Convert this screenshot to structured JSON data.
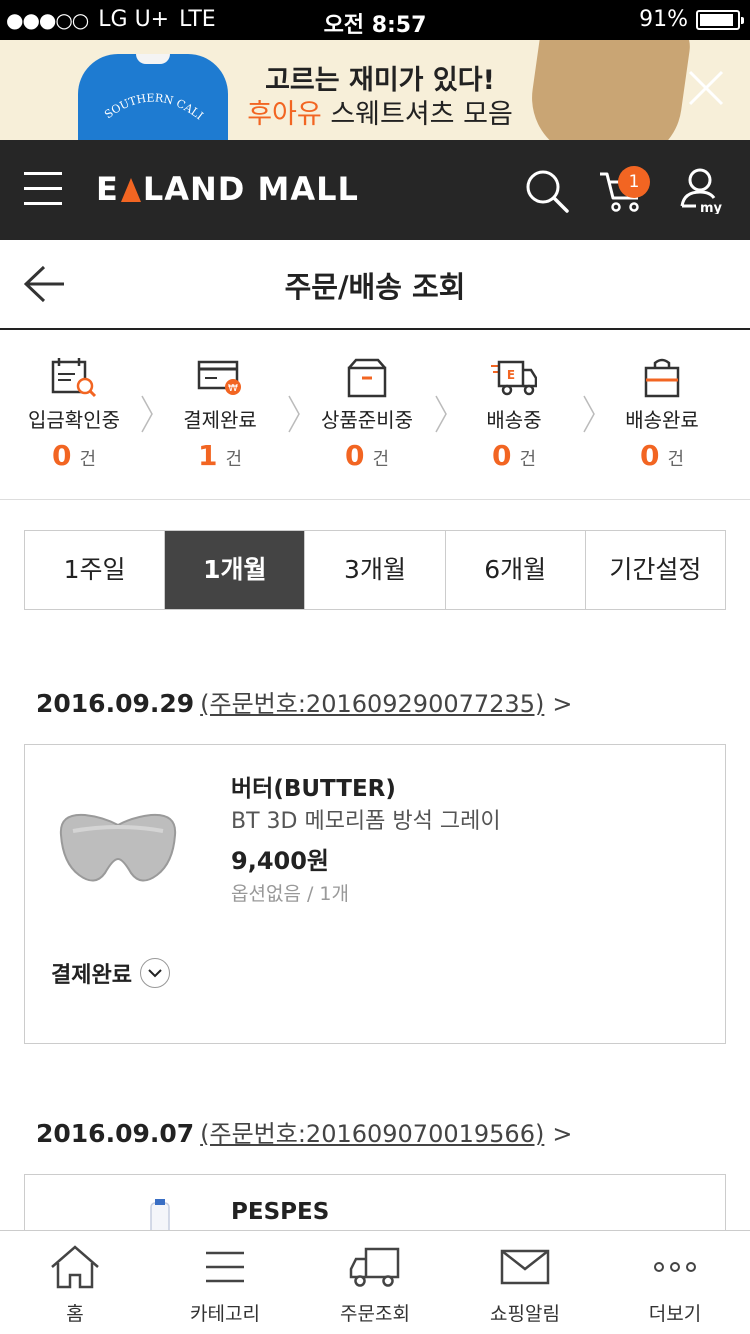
{
  "status_bar": {
    "signal": "●●●○○",
    "carrier": "LG U+",
    "network": "LTE",
    "time": "오전 8:57",
    "battery": "91%",
    "battery_level": 0.91
  },
  "banner": {
    "headline": "고르는 재미가 있다!",
    "subline_accent": "후아유",
    "subline_rest": " 스웨트셔츠 모음",
    "shirt_text": "SOUTHERN CALIF"
  },
  "header": {
    "logo_part1": "E",
    "logo_part2": "LAND MALL",
    "cart_count": "1",
    "my_label": "my"
  },
  "page": {
    "title": "주문/배송 조회"
  },
  "steps": [
    {
      "label": "입금확인중",
      "count": "0",
      "unit": "건"
    },
    {
      "label": "결제완료",
      "count": "1",
      "unit": "건"
    },
    {
      "label": "상품준비중",
      "count": "0",
      "unit": "건"
    },
    {
      "label": "배송중",
      "count": "0",
      "unit": "건"
    },
    {
      "label": "배송완료",
      "count": "0",
      "unit": "건"
    }
  ],
  "period_tabs": [
    "1주일",
    "1개월",
    "3개월",
    "6개월",
    "기간설정"
  ],
  "period_selected": "1개월",
  "orders": [
    {
      "date": "2016.09.29",
      "order_no": "(주문번호:201609290077235)",
      "arrow": ">",
      "brand": "버터(BUTTER)",
      "product": "BT 3D 메모리폼 방석 그레이",
      "price": "9,400원",
      "option": "옵션없음 / 1개",
      "status": "결제완료"
    },
    {
      "date": "2016.09.07",
      "order_no": "(주문번호:201609070019566)",
      "arrow": ">",
      "brand": "PESPES"
    }
  ],
  "bottom_nav": [
    "홈",
    "카테고리",
    "주문조회",
    "쇼핑알림",
    "더보기"
  ],
  "colors": {
    "accent": "#f26522",
    "header_bg": "#262626",
    "banner_bg": "#f7efd9",
    "active_tab": "#444444"
  }
}
